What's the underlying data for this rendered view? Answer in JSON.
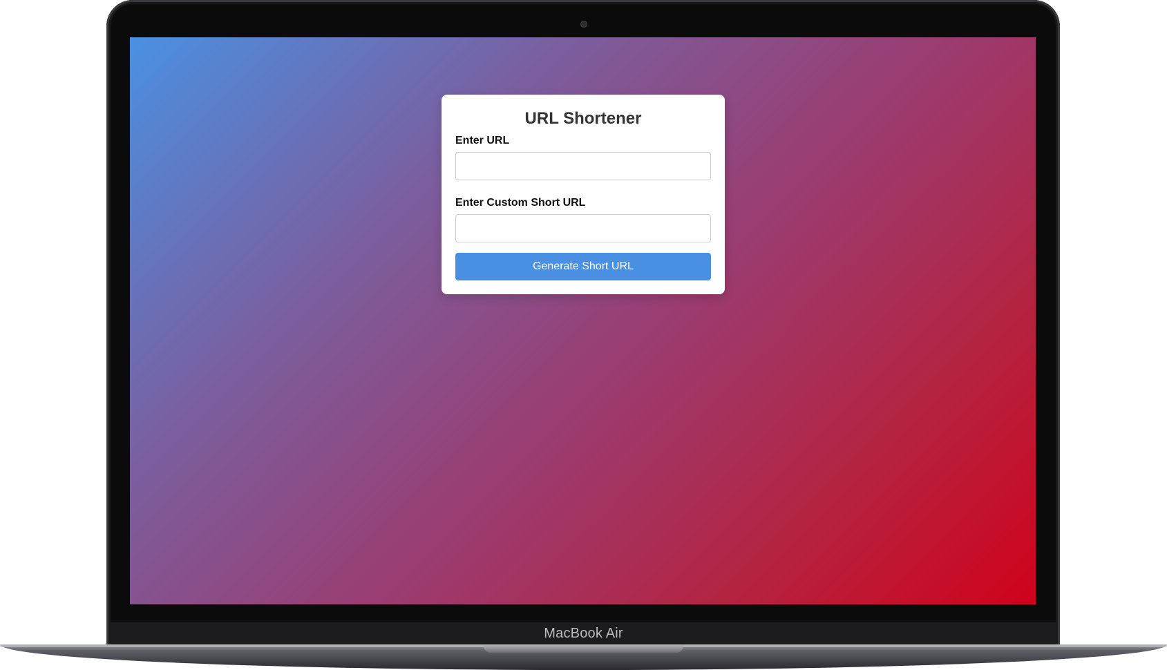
{
  "device": {
    "brand_label": "MacBook Air"
  },
  "app": {
    "title": "URL Shortener",
    "url_field": {
      "label": "Enter URL",
      "value": "",
      "placeholder": ""
    },
    "custom_field": {
      "label": "Enter Custom Short URL",
      "value": "",
      "placeholder": ""
    },
    "submit_label": "Generate Short URL"
  },
  "colors": {
    "accent": "#4a90e2",
    "gradient_start": "#4a90e2",
    "gradient_end": "#d0021b"
  }
}
